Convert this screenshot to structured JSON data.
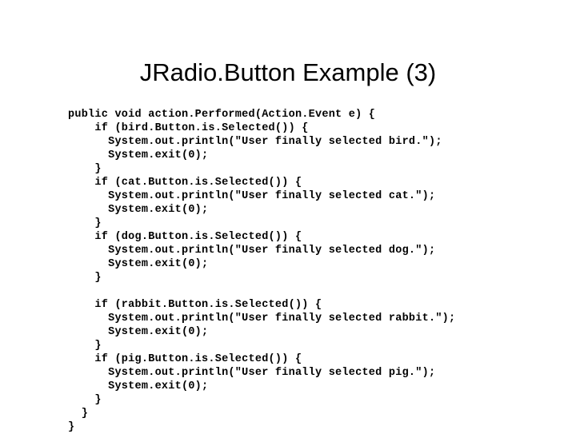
{
  "slide": {
    "title": "JRadio.Button Example (3)",
    "background_color": "#ffffff",
    "text_color": "#000000"
  },
  "code": {
    "language": "java",
    "lines": [
      "public void action.Performed(Action.Event e) {",
      "    if (bird.Button.is.Selected()) {",
      "      System.out.println(\"User finally selected bird.\");",
      "      System.exit(0);",
      "    }",
      "    if (cat.Button.is.Selected()) {",
      "      System.out.println(\"User finally selected cat.\");",
      "      System.exit(0);",
      "    }",
      "    if (dog.Button.is.Selected()) {",
      "      System.out.println(\"User finally selected dog.\");",
      "      System.exit(0);",
      "    }",
      "",
      "    if (rabbit.Button.is.Selected()) {",
      "      System.out.println(\"User finally selected rabbit.\");",
      "      System.exit(0);",
      "    }",
      "    if (pig.Button.is.Selected()) {",
      "      System.out.println(\"User finally selected pig.\");",
      "      System.exit(0);",
      "    }",
      "  }",
      "}"
    ]
  }
}
